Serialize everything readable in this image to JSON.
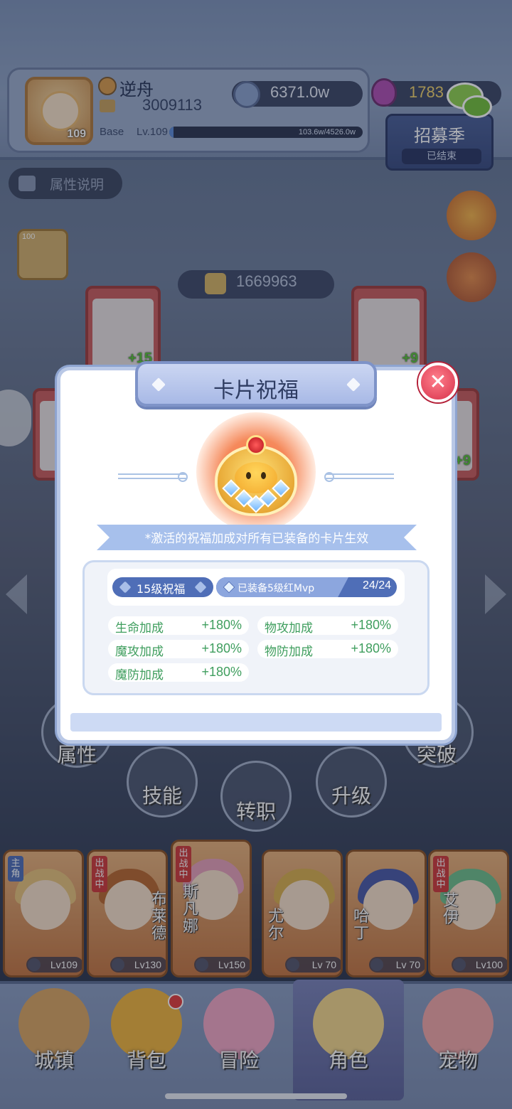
{
  "player": {
    "name": "逆舟",
    "power": "3009113",
    "avatar_level": "109",
    "base_label": "Base",
    "level_label": "Lv.109",
    "exp_text": "103.6w/4526.0w",
    "exp_progress": 0.023
  },
  "currency": {
    "zeny": "6371.0w",
    "potion": "1783"
  },
  "recruit": {
    "title": "招募季",
    "status": "已结束"
  },
  "attr_info_button": "属性说明",
  "equip_slot_level": "100",
  "stage_score": "1669963",
  "card_slots": [
    {
      "plus": "+15"
    },
    {
      "plus": "+9"
    },
    {
      "plus": "+9"
    }
  ],
  "modal": {
    "title": "卡片祝福",
    "close_symbol": "✕",
    "note": "*激活的祝福加成对所有已装备的卡片生效",
    "level_badge": "15级祝福",
    "equip_status": "已装备5级红Mvp",
    "equip_count": "24/24",
    "stats": [
      {
        "label": "生命加成",
        "value": "+180%"
      },
      {
        "label": "物攻加成",
        "value": "+180%"
      },
      {
        "label": "魔攻加成",
        "value": "+180%"
      },
      {
        "label": "物防加成",
        "value": "+180%"
      },
      {
        "label": "魔防加成",
        "value": "+180%"
      }
    ]
  },
  "function_buttons": [
    {
      "label": "属性"
    },
    {
      "label": "技能"
    },
    {
      "label": "转职"
    },
    {
      "label": "升级"
    },
    {
      "label": "突破"
    }
  ],
  "heroes": [
    {
      "tag": "主角",
      "name": "",
      "level": "Lv109",
      "color": "#e6c27a"
    },
    {
      "tag": "出战中",
      "name": "布莱德",
      "level": "Lv130",
      "color": "#b8682e"
    },
    {
      "tag": "出战中",
      "name": "斯凡娜",
      "level": "Lv150",
      "color": "#e7a0b8"
    },
    {
      "tag": "",
      "name": "尤尔",
      "level": "Lv 70",
      "color": "#d9b04d"
    },
    {
      "tag": "",
      "name": "哈丁",
      "level": "Lv 70",
      "color": "#4a5aa6"
    },
    {
      "tag": "出战中",
      "name": "艾伊",
      "level": "Lv100",
      "color": "#6fbf8a"
    }
  ],
  "bottom_nav": [
    {
      "label": "城镇",
      "icon": "castle-icon",
      "color": "#d9a561"
    },
    {
      "label": "背包",
      "icon": "backpack-icon",
      "color": "#f0b43c"
    },
    {
      "label": "冒险",
      "icon": "poring-icon",
      "color": "#f1a6c4"
    },
    {
      "label": "角色",
      "icon": "character-icon",
      "color": "#f3d68a"
    },
    {
      "label": "宠物",
      "icon": "paw-icon",
      "color": "#f2a7a7"
    }
  ],
  "colors": {
    "accent": "#4f6eb7",
    "stat_green": "#3f9e5e",
    "close_red": "#d7314a"
  }
}
